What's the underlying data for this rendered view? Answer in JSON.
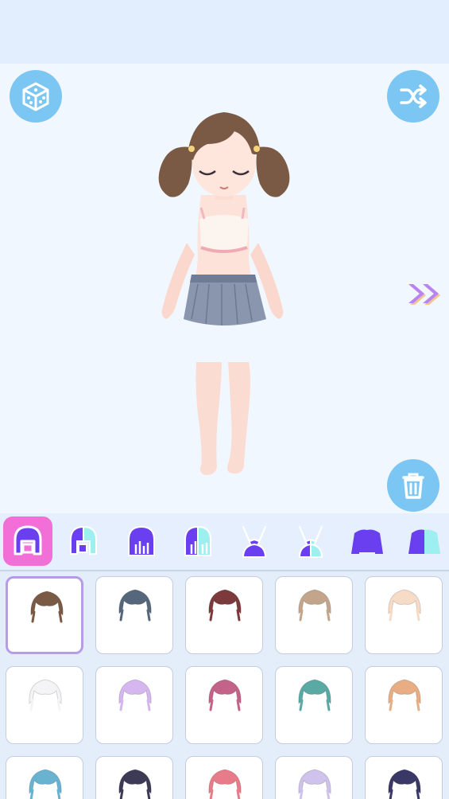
{
  "toolbar": {
    "random_icon": "dice-icon",
    "shuffle_icon": "shuffle-icon",
    "delete_icon": "trash-icon",
    "next_icon": "double-chevron-right-icon"
  },
  "colors": {
    "accent_button": "#7cc6f3",
    "active_tab": "#f26fd7",
    "tab_icon": "#6a3ff0",
    "selected_border": "#b79be8",
    "next_arrow": "#b883f3"
  },
  "categories": [
    {
      "id": "hair-front",
      "icon": "front-hair-icon",
      "selected": true
    },
    {
      "id": "hair-front-alt",
      "icon": "front-hair-split-icon",
      "selected": false
    },
    {
      "id": "hair-back",
      "icon": "back-hair-icon",
      "selected": false
    },
    {
      "id": "hair-back-alt",
      "icon": "back-hair-split-icon",
      "selected": false
    },
    {
      "id": "ears",
      "icon": "bunny-ears-icon",
      "selected": false
    },
    {
      "id": "ears-alt",
      "icon": "bunny-ears-split-icon",
      "selected": false
    },
    {
      "id": "top",
      "icon": "sweater-icon",
      "selected": false
    },
    {
      "id": "top-alt",
      "icon": "sweater-split-icon",
      "selected": false
    }
  ],
  "hair_options": [
    {
      "color": "#7a5a45",
      "selected": true
    },
    {
      "color": "#56677b",
      "selected": false
    },
    {
      "color": "#7d3a3c",
      "selected": false
    },
    {
      "color": "#c3a58c",
      "selected": false
    },
    {
      "color": "#f6dcc6",
      "selected": false
    },
    {
      "color": "#f4f4f6",
      "selected": false
    },
    {
      "color": "#d5b6ee",
      "selected": false
    },
    {
      "color": "#c36389",
      "selected": false
    },
    {
      "color": "#59a9a4",
      "selected": false
    },
    {
      "color": "#e8ad82",
      "selected": false
    },
    {
      "color": "#6ab3d0",
      "selected": false
    },
    {
      "color": "#3d3a55",
      "selected": false
    },
    {
      "color": "#e87b89",
      "selected": false
    },
    {
      "color": "#cfc2ed",
      "selected": false
    },
    {
      "color": "#3a3866",
      "selected": false
    }
  ]
}
